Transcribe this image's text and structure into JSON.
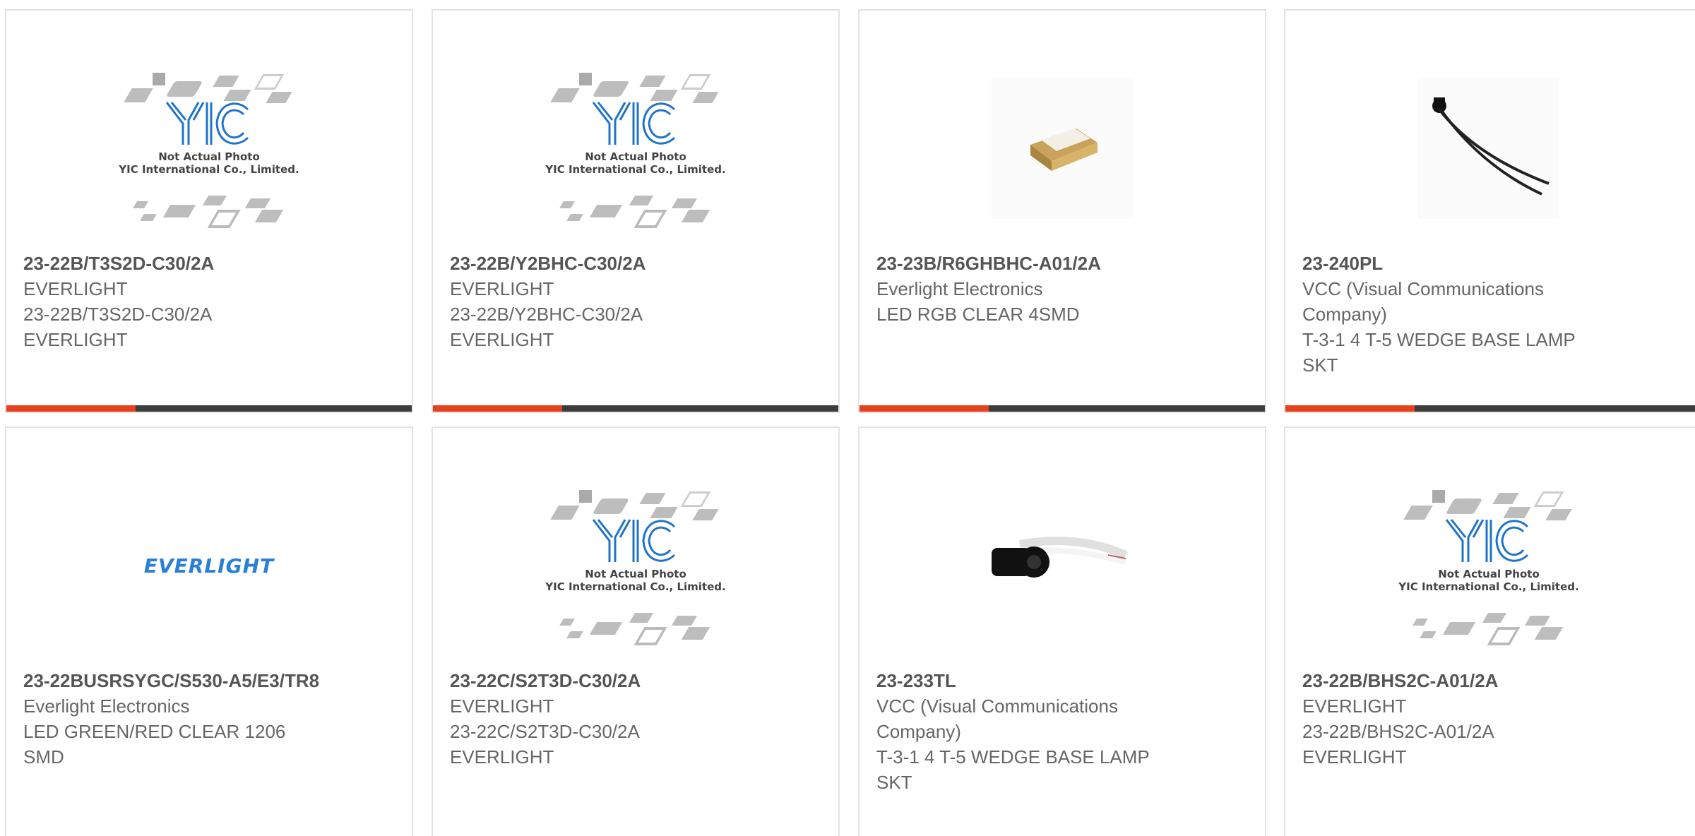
{
  "colors": {
    "accent": "#e8401c",
    "bar": "#3c3c3c"
  },
  "cards": [
    {
      "part": "23-22B/T3S2D-C30/2A",
      "lines": [
        "EVERLIGHT",
        "23-22B/T3S2D-C30/2A",
        "EVERLIGHT"
      ],
      "image": "yic-placeholder"
    },
    {
      "part": "23-22B/Y2BHC-C30/2A",
      "lines": [
        "EVERLIGHT",
        "23-22B/Y2BHC-C30/2A",
        "EVERLIGHT"
      ],
      "image": "yic-placeholder"
    },
    {
      "part": "23-23B/R6GHBHC-A01/2A",
      "lines": [
        "Everlight Electronics",
        "LED RGB CLEAR 4SMD"
      ],
      "image": "smd-led-photo"
    },
    {
      "part": "23-240PL",
      "lines": [
        "VCC (Visual Communications Company)",
        "T-3-1 4 T-5 WEDGE BASE LAMP SKT"
      ],
      "image": "lamp-socket-photo"
    },
    {
      "part": "23-22BUSRSYGC/S530-A5/E3/TR8",
      "lines": [
        "Everlight Electronics",
        "LED GREEN/RED CLEAR 1206 SMD"
      ],
      "image": "everlight-logo"
    },
    {
      "part": "23-22C/S2T3D-C30/2A",
      "lines": [
        "EVERLIGHT",
        "23-22C/S2T3D-C30/2A",
        "EVERLIGHT"
      ],
      "image": "yic-placeholder"
    },
    {
      "part": "23-233TL",
      "lines": [
        "VCC (Visual Communications Company)",
        "T-3-1 4 T-5 WEDGE BASE LAMP SKT"
      ],
      "image": "lamp-socket-photo"
    },
    {
      "part": "23-22B/BHS2C-A01/2A",
      "lines": [
        "EVERLIGHT",
        "23-22B/BHS2C-A01/2A",
        "EVERLIGHT"
      ],
      "image": "yic-placeholder"
    }
  ],
  "placeholder": {
    "line1": "Not Actual Photo",
    "line2": "YIC International Co., Limited."
  },
  "everlight_logo_text": "EVERLIGHT"
}
